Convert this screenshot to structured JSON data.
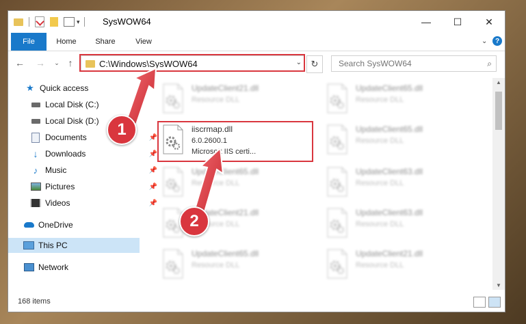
{
  "window": {
    "title": "SysWOW64",
    "controls": {
      "minimize": "—",
      "maximize": "☐",
      "close": "✕"
    }
  },
  "ribbon": {
    "tabs": [
      {
        "label": "File",
        "active": true
      },
      {
        "label": "Home"
      },
      {
        "label": "Share"
      },
      {
        "label": "View"
      }
    ]
  },
  "address": {
    "path": "C:\\Windows\\SysWOW64",
    "search_placeholder": "Search SysWOW64"
  },
  "nav": {
    "items": [
      {
        "label": "Quick access",
        "icon": "star-icon"
      },
      {
        "label": "Local Disk (C:)",
        "icon": "drive-icon"
      },
      {
        "label": "Local Disk (D:)",
        "icon": "drive-icon"
      },
      {
        "label": "Documents",
        "icon": "documents-icon",
        "pinned": true
      },
      {
        "label": "Downloads",
        "icon": "download-icon",
        "pinned": true
      },
      {
        "label": "Music",
        "icon": "music-icon",
        "pinned": true
      },
      {
        "label": "Pictures",
        "icon": "pictures-icon",
        "pinned": true
      },
      {
        "label": "Videos",
        "icon": "videos-icon",
        "pinned": true
      },
      {
        "label": "OneDrive",
        "icon": "cloud-icon"
      },
      {
        "label": "This PC",
        "icon": "pc-icon",
        "selected": true
      },
      {
        "label": "Network",
        "icon": "network-icon"
      }
    ]
  },
  "files": {
    "left": [
      {
        "name": "UpdateClient21.dll",
        "desc": "Resource DLL"
      },
      {
        "name": "iiscrmap.dll",
        "version": "6.0.2600.1",
        "desc": "Microsoft IIS certi...",
        "focus": true
      },
      {
        "name": "UpdateClient65.dll",
        "desc": "Resource DLL"
      },
      {
        "name": "UpdateClient21.dll",
        "desc": "Resource DLL"
      },
      {
        "name": "UpdateClient65.dll",
        "desc": "Resource DLL"
      }
    ],
    "right": [
      {
        "name": "UpdateClient65.dll",
        "desc": "Resource DLL"
      },
      {
        "name": "UpdateClient65.dll",
        "desc": "Resource DLL"
      },
      {
        "name": "UpdateClient63.dll",
        "desc": "Resource DLL"
      },
      {
        "name": "UpdateClient63.dll",
        "desc": "Resource DLL"
      },
      {
        "name": "UpdateClient21.dll",
        "desc": "Resource DLL"
      }
    ]
  },
  "status": {
    "items_count": "168 items"
  },
  "annotations": {
    "step1": "1",
    "step2": "2"
  },
  "colors": {
    "accent": "#1979ca",
    "highlight": "#d9363e"
  }
}
